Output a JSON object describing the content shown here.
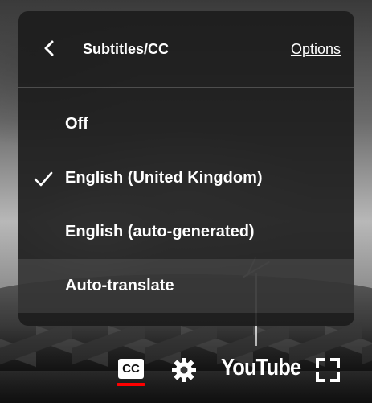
{
  "panel": {
    "title": "Subtitles/CC",
    "options_label": "Options",
    "items": [
      {
        "label": "Off",
        "selected": false
      },
      {
        "label": "English (United Kingdom)",
        "selected": true
      },
      {
        "label": "English (auto-generated)",
        "selected": false
      },
      {
        "label": "Auto-translate",
        "selected": false,
        "highlighted": true
      }
    ]
  },
  "controls": {
    "cc_label": "CC",
    "logo_text": "YouTube",
    "icons": [
      "chevron-left-icon",
      "check-icon",
      "cc-icon",
      "gear-icon",
      "fullscreen-icon"
    ]
  },
  "colors": {
    "accent": "#ff0000",
    "panel_bg": "#1c1c1c",
    "text": "#ffffff"
  }
}
